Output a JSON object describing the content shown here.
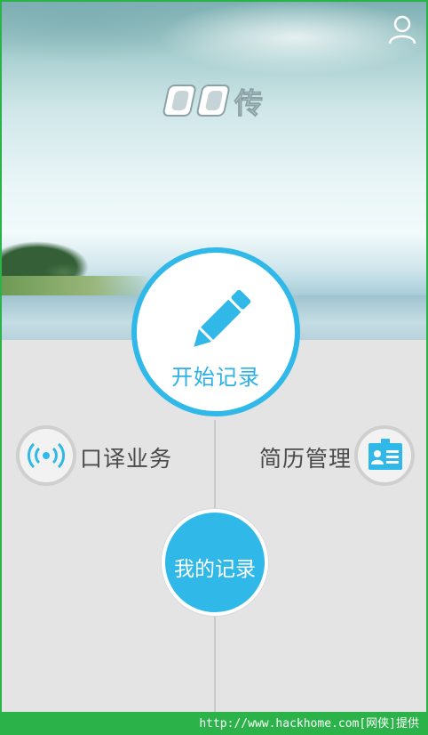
{
  "app": {
    "logo_text": "DD传"
  },
  "header": {
    "user_icon": "user-icon"
  },
  "main": {
    "start_record_label": "开始记录",
    "interpretation_label": "口译业务",
    "resume_label": "简历管理",
    "my_records_label": "我的记录"
  },
  "footer": {
    "watermark": "http://www.hackhome.com[网侠]提供"
  },
  "colors": {
    "accent": "#30b8e8",
    "border": "#2bb34a",
    "text": "#4a4a4a"
  }
}
